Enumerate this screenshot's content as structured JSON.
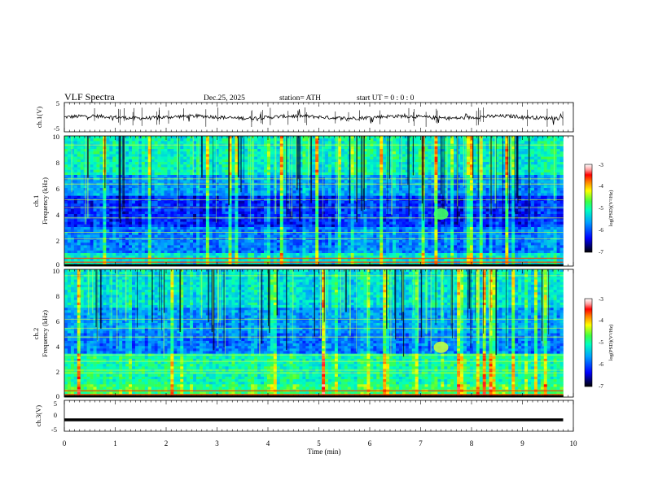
{
  "header": {
    "title": "VLF  Spectra",
    "date": "Dec.25, 2025",
    "station": "station= ATH",
    "start_ut": "start  UT  =    0 : 0  : 0"
  },
  "chart_data": [
    {
      "type": "line",
      "panel": "ch1-waveform",
      "ylabel": "ch.1(V)",
      "ylim": [
        -5,
        5
      ],
      "yticks": [
        "5",
        "-5"
      ],
      "xlim": [
        0,
        10
      ],
      "x_end": 9.8,
      "baseline_y": 0
    },
    {
      "type": "heatmap",
      "panel": "ch1-spectrogram",
      "ylabel_channel": "ch.1",
      "ylabel": "Frequency  (kHz)",
      "ylim": [
        0,
        10
      ],
      "yticks": [
        "10",
        "8",
        "6",
        "4",
        "2",
        "0"
      ],
      "xlim": [
        0,
        10
      ],
      "x_end": 9.8,
      "colorbar": {
        "label": "log(PSD)(V²/Hz)",
        "range": [
          -7,
          -3
        ],
        "ticks": [
          "-3",
          "-4",
          "-5",
          "-6",
          "-7"
        ]
      },
      "feature": {
        "time_min": 7.4,
        "freq_khz": 4,
        "label": ""
      }
    },
    {
      "type": "heatmap",
      "panel": "ch2-spectrogram",
      "ylabel_channel": "ch.2",
      "ylabel": "Frequency  (kHz)",
      "ylim": [
        0,
        10
      ],
      "yticks": [
        "10",
        "8",
        "6",
        "4",
        "2",
        "0"
      ],
      "xlim": [
        0,
        10
      ],
      "x_end": 9.8,
      "colorbar": {
        "label": "log(PSD)(V²/Hz)",
        "range": [
          -7,
          -3
        ],
        "ticks": [
          "-3",
          "-4",
          "-5",
          "-6",
          "-7"
        ]
      },
      "feature": {
        "time_min": 7.4,
        "freq_khz": 3.9,
        "label": ""
      }
    },
    {
      "type": "line",
      "panel": "ch3-waveform",
      "ylabel": "ch.3(V)",
      "ylim": [
        -5,
        5
      ],
      "yticks": [
        "5",
        "0",
        "-5"
      ],
      "xlim": [
        0,
        10
      ],
      "x_end": 9.8,
      "baseline_y": -1.3
    }
  ],
  "x_axis": {
    "label": "Time  (min)",
    "ticks": [
      "0",
      "1",
      "2",
      "3",
      "4",
      "5",
      "6",
      "7",
      "8",
      "9",
      "10"
    ]
  }
}
